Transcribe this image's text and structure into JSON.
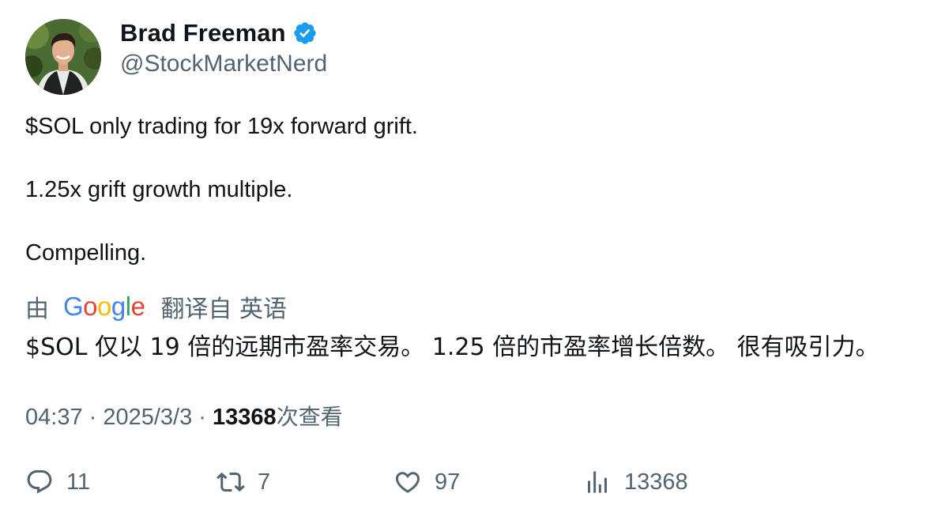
{
  "author": {
    "name": "Brad Freeman",
    "handle": "@StockMarketNerd",
    "verified": true,
    "verified_color": "#1d9bf0"
  },
  "tweet": {
    "lines": [
      "$SOL only trading for 19x forward grift.",
      "1.25x grift growth multiple.",
      "Compelling."
    ]
  },
  "translation": {
    "prefix": "由",
    "provider_logo_text": "Google",
    "suffix": "翻译自 英语",
    "text": "$SOL 仅以 19 倍的远期市盈率交易。 1.25 倍的市盈率增长倍数。 很有吸引力。"
  },
  "meta": {
    "time": "04:37",
    "sep1": " · ",
    "date": "2025/3/3",
    "sep2": " · ",
    "views_count": "13368",
    "views_label": "次查看"
  },
  "actions": {
    "replies": "11",
    "retweets": "7",
    "likes": "97",
    "views": "13368"
  },
  "colors": {
    "text_primary": "#0f1419",
    "text_secondary": "#536471",
    "google_blue": "#4285F4",
    "google_red": "#EA4335",
    "google_yellow": "#FBBC05",
    "google_green": "#34A853"
  }
}
